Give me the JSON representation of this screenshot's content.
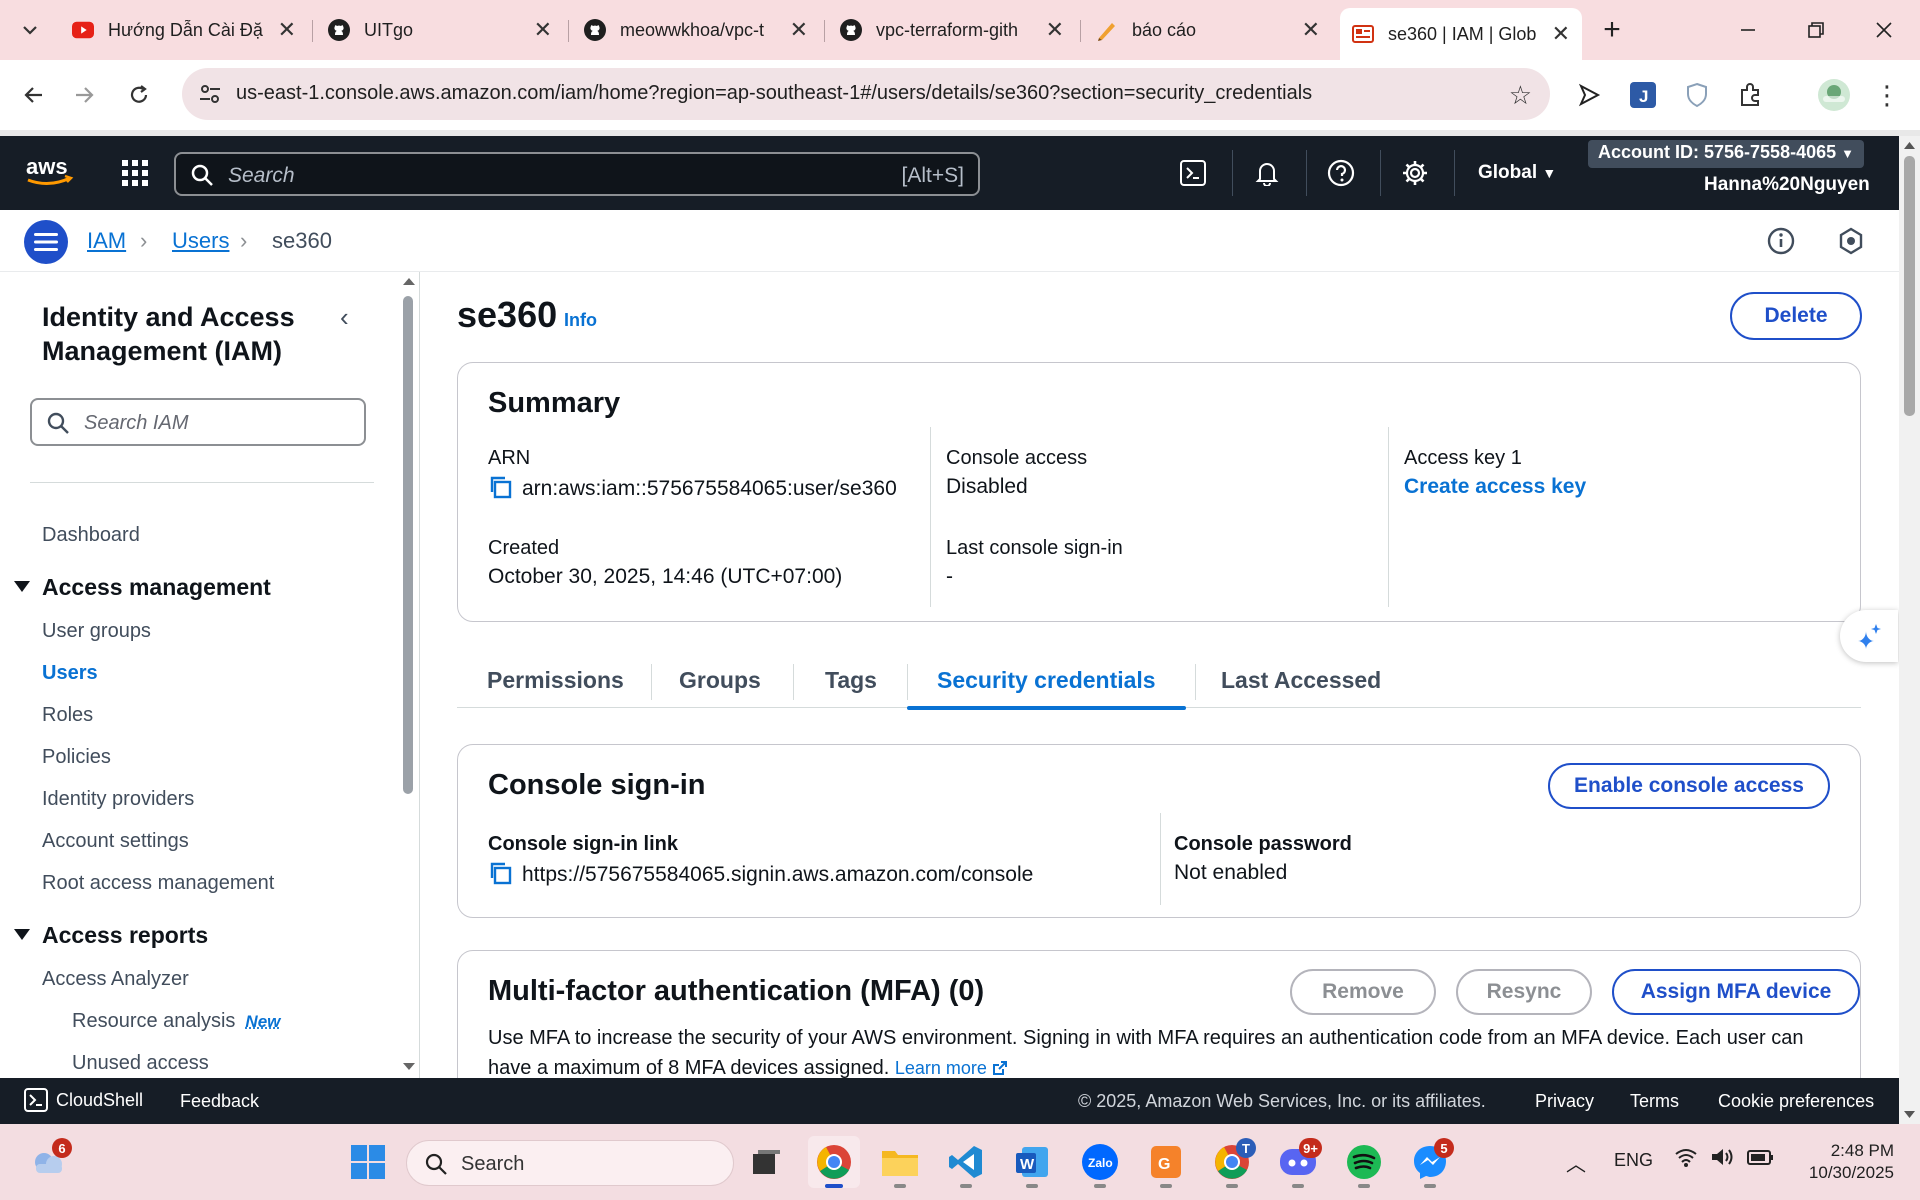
{
  "browser": {
    "tabs": [
      {
        "title": "Hướng Dẫn Cài Đặ",
        "favicon": "youtube-icon"
      },
      {
        "title": "UITgo",
        "favicon": "github-icon"
      },
      {
        "title": "meowwkhoa/vpc-t",
        "favicon": "github-icon"
      },
      {
        "title": "vpc-terraform-gith",
        "favicon": "github-icon"
      },
      {
        "title": "báo cáo",
        "favicon": "notebook-icon"
      },
      {
        "title": "se360 | IAM | Glob",
        "favicon": "aws-console-icon"
      }
    ],
    "url": "us-east-1.console.aws.amazon.com/iam/home?region=ap-southeast-1#/users/details/se360?section=security_credentials"
  },
  "aws_nav": {
    "search_placeholder": "Search",
    "search_shortcut": "[Alt+S]",
    "region": "Global",
    "account": "Account ID: 5756-7558-4065",
    "username": "Hanna%20Nguyen"
  },
  "breadcrumb": {
    "items": [
      "IAM",
      "Users"
    ],
    "current": "se360"
  },
  "sidebar": {
    "title": "Identity and Access Management (IAM)",
    "search_placeholder": "Search IAM",
    "dashboard": "Dashboard",
    "access_management": {
      "heading": "Access management",
      "items": [
        "User groups",
        "Users",
        "Roles",
        "Policies",
        "Identity providers",
        "Account settings",
        "Root access management"
      ]
    },
    "access_reports": {
      "heading": "Access reports",
      "items": [
        "Access Analyzer"
      ],
      "sub_items": [
        "Resource analysis",
        "Unused access"
      ],
      "new_badge": "New"
    }
  },
  "page": {
    "title": "se360",
    "info": "Info",
    "delete_label": "Delete",
    "summary": {
      "heading": "Summary",
      "arn_label": "ARN",
      "arn_value": "arn:aws:iam::575675584065:user/se360",
      "created_label": "Created",
      "created_value": "October 30, 2025, 14:46 (UTC+07:00)",
      "console_access_label": "Console access",
      "console_access_value": "Disabled",
      "last_signin_label": "Last console sign-in",
      "last_signin_value": "-",
      "access_key_label": "Access key 1",
      "access_key_link": "Create access key"
    },
    "tabs": [
      "Permissions",
      "Groups",
      "Tags",
      "Security credentials",
      "Last Accessed"
    ],
    "active_tab": "Security credentials",
    "console_signin": {
      "heading": "Console sign-in",
      "enable_label": "Enable console access",
      "link_label": "Console sign-in link",
      "link_value": "https://575675584065.signin.aws.amazon.com/console",
      "password_label": "Console password",
      "password_value": "Not enabled"
    },
    "mfa": {
      "heading": "Multi-factor authentication (MFA) (0)",
      "remove_label": "Remove",
      "resync_label": "Resync",
      "assign_label": "Assign MFA device",
      "description": "Use MFA to increase the security of your AWS environment. Signing in with MFA requires an authentication code from an MFA device. Each user can have a maximum of 8 MFA devices assigned.",
      "learn_more": "Learn more"
    }
  },
  "footer": {
    "cloudshell": "CloudShell",
    "feedback": "Feedback",
    "copyright": "© 2025, Amazon Web Services, Inc. or its affiliates.",
    "privacy": "Privacy",
    "terms": "Terms",
    "cookies": "Cookie preferences"
  },
  "taskbar": {
    "weather_badge": "6",
    "search_placeholder": "Search",
    "discord_badge": "9+",
    "chrome_profile_badge": "T",
    "messenger_badge": "5",
    "lang": "ENG",
    "time": "2:48 PM",
    "date": "10/30/2025"
  },
  "colors": {
    "aws_nav_bg": "#161d26",
    "link_blue": "#0972d3",
    "primary_button": "#1f4fc9",
    "browser_chrome": "#f8dde0"
  }
}
